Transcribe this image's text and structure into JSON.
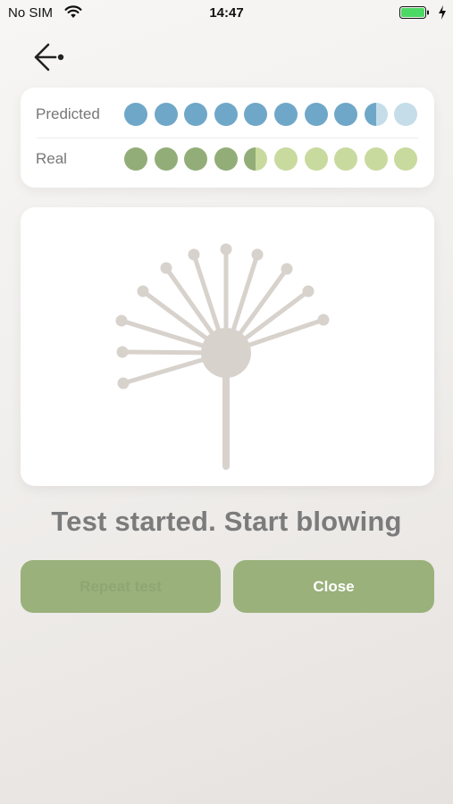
{
  "status_bar": {
    "carrier": "No SIM",
    "time": "14:47"
  },
  "legend": {
    "predicted_label": "Predicted",
    "real_label": "Real",
    "predicted_color": "#6fa7c8",
    "predicted_light_color": "#c4dde8",
    "real_color": "#93ad78",
    "real_light_color": "#c8da9e",
    "dot_count": 10,
    "predicted_filled": 8.5,
    "real_filled": 4.5
  },
  "message": "Test started. Start blowing",
  "buttons": {
    "repeat_label": "Repeat test",
    "close_label": "Close"
  },
  "colors": {
    "dandelion": "#d8d2cd",
    "button_bg": "#9ab17b"
  }
}
